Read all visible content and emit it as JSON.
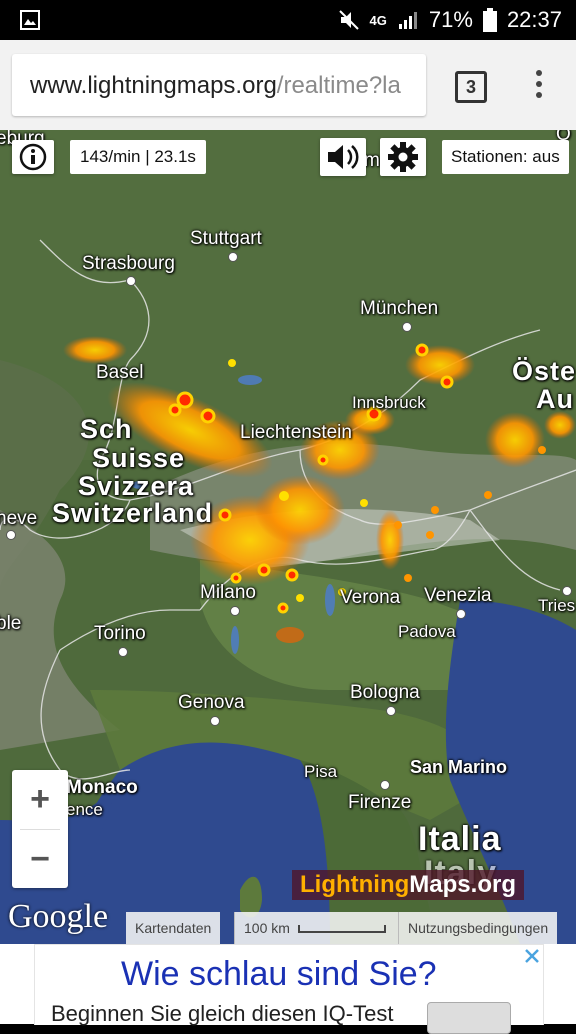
{
  "status_bar": {
    "network": "4G",
    "battery_percent": "71%",
    "time": "22:37",
    "icons": [
      "image-icon",
      "mute-icon",
      "signal-icon",
      "battery-icon"
    ]
  },
  "browser": {
    "url_domain": "www.lightningmaps.org",
    "url_path": "/realtime?la",
    "tab_count": "3"
  },
  "map": {
    "controls": {
      "info_icon": "info-icon",
      "rate_text": "143/min | 23.1s",
      "sound_icon": "speaker-icon",
      "settings_icon": "gear-icon",
      "stations_label": "Stationen: aus"
    },
    "partial_edge_labels": [
      "eburg",
      "Ulm",
      "Ö",
      "Öste",
      "Au",
      "Sch",
      "neve",
      "ble",
      "Tries",
      "ence",
      "Italy"
    ],
    "cities": [
      "Stuttgart",
      "Strasbourg",
      "München",
      "Basel",
      "Liechtenstein",
      "Innsbruck",
      "Milano",
      "Verona",
      "Venezia",
      "Padova",
      "Torino",
      "Genova",
      "Bologna",
      "Pisa",
      "San Marino",
      "Firenze",
      "Monaco"
    ],
    "countries": [
      "Schweiz",
      "Suisse",
      "Svizzera",
      "Switzerland",
      "Italia"
    ],
    "zoom_in": "+",
    "zoom_out": "−",
    "google_logo": "Google",
    "lightningmaps_logo_a": "Lightning",
    "lightningmaps_logo_b": "Maps.org",
    "attribution": {
      "map_data": "Kartendaten",
      "scale": "100 km",
      "terms": "Nutzungsbedingungen"
    },
    "colors": {
      "strike_recent": "#ff2a00",
      "strike_old": "#ff9a00",
      "sea": "#2f4a8f"
    }
  },
  "ad": {
    "title": "Wie schlau sind Sie?",
    "text": "Beginnen Sie gleich diesen IQ-Test",
    "close_icon": "close-icon"
  }
}
